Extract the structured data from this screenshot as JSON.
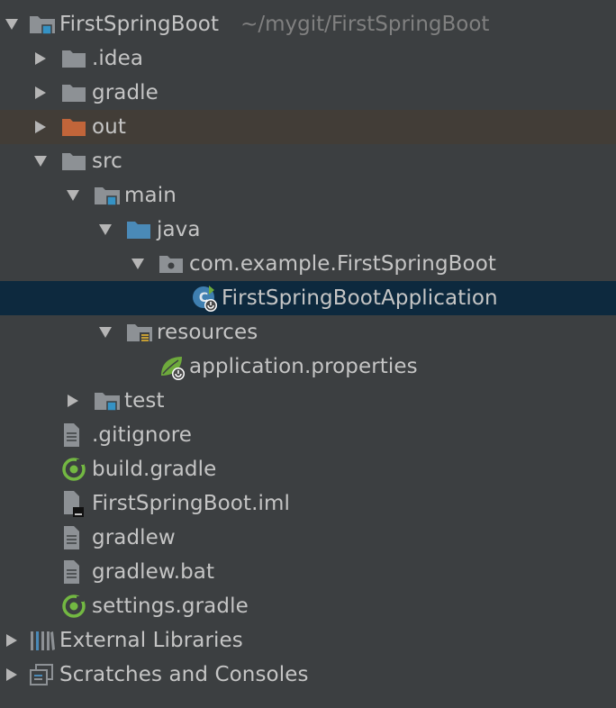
{
  "tree": {
    "root": {
      "label": "FirstSpringBoot",
      "path": "~/mygit/FirstSpringBoot"
    },
    "idea": {
      "label": ".idea"
    },
    "gradle_dir": {
      "label": "gradle"
    },
    "out": {
      "label": "out"
    },
    "src": {
      "label": "src"
    },
    "main": {
      "label": "main"
    },
    "java": {
      "label": "java"
    },
    "package": {
      "label": "com.example.FirstSpringBoot"
    },
    "app_class": {
      "label": "FirstSpringBootApplication"
    },
    "resources": {
      "label": "resources"
    },
    "app_props": {
      "label": "application.properties"
    },
    "test": {
      "label": "test"
    },
    "gitignore": {
      "label": ".gitignore"
    },
    "build_gradle": {
      "label": "build.gradle"
    },
    "iml": {
      "label": "FirstSpringBoot.iml"
    },
    "gradlew": {
      "label": "gradlew"
    },
    "gradlew_bat": {
      "label": "gradlew.bat"
    },
    "settings_gradle": {
      "label": "settings.gradle"
    },
    "external_libs": {
      "label": "External Libraries"
    },
    "scratches": {
      "label": "Scratches and Consoles"
    }
  },
  "colors": {
    "background": "#3c3f41",
    "selection": "#0d293e",
    "excluded_row": "#423d37",
    "folder": "#8d9195",
    "source_folder": "#4a8ab8",
    "excluded_folder": "#c1653a",
    "gradle_green": "#73b842",
    "spring_green": "#6eaa3c"
  }
}
